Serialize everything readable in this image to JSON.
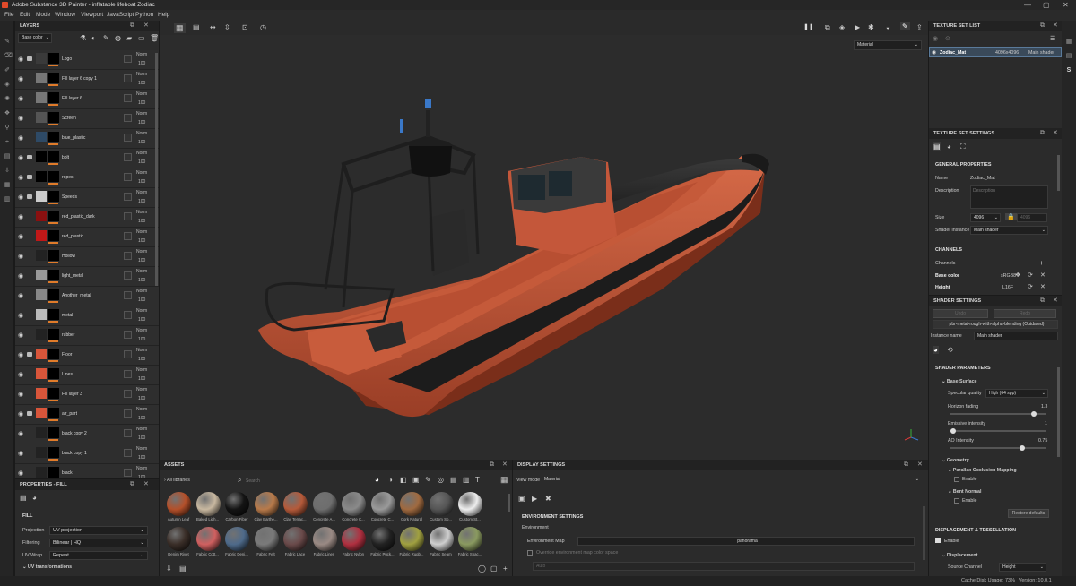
{
  "window": {
    "title": "Adobe Substance 3D Painter - inflatable lifeboat Zodiac",
    "controls": [
      "—",
      "▢",
      "✕"
    ]
  },
  "menu": [
    "File",
    "Edit",
    "Mode",
    "Window",
    "Viewport",
    "JavaScript",
    "Python",
    "Help"
  ],
  "layers": {
    "title": "LAYERS",
    "channel": "Base color",
    "items": [
      {
        "name": "Logo",
        "blend": "Norm",
        "opacity": "100",
        "thumb": "#3a3a3a",
        "folder": true
      },
      {
        "name": "Fill layer 6 copy 1",
        "blend": "Norm",
        "opacity": "100",
        "thumb": "#777",
        "folder": false
      },
      {
        "name": "Fill layer 6",
        "blend": "Norm",
        "opacity": "100",
        "thumb": "#777",
        "folder": false
      },
      {
        "name": "Screen",
        "blend": "Norm",
        "opacity": "100",
        "thumb": "#555",
        "folder": false
      },
      {
        "name": "blue_plastic",
        "blend": "Norm",
        "opacity": "100",
        "thumb": "#2e4a66",
        "folder": false
      },
      {
        "name": "bolt",
        "blend": "Norm",
        "opacity": "100",
        "thumb": "#000",
        "folder": true
      },
      {
        "name": "ropes",
        "blend": "Norm",
        "opacity": "100",
        "thumb": "#000",
        "folder": true
      },
      {
        "name": "Speeds",
        "blend": "Norm",
        "opacity": "100",
        "thumb": "#ccc",
        "folder": true
      },
      {
        "name": "red_plastic_dark",
        "blend": "Norm",
        "opacity": "100",
        "thumb": "#8a1010",
        "folder": false
      },
      {
        "name": "red_plastic",
        "blend": "Norm",
        "opacity": "100",
        "thumb": "#c01818",
        "folder": false
      },
      {
        "name": "Hollow",
        "blend": "Norm",
        "opacity": "100",
        "thumb": "#222",
        "folder": false
      },
      {
        "name": "light_metal",
        "blend": "Norm",
        "opacity": "100",
        "thumb": "#999",
        "folder": false
      },
      {
        "name": "Another_metal",
        "blend": "Norm",
        "opacity": "100",
        "thumb": "#888",
        "folder": false
      },
      {
        "name": "metal",
        "blend": "Norm",
        "opacity": "100",
        "thumb": "#bbb",
        "folder": false
      },
      {
        "name": "rubber",
        "blend": "Norm",
        "opacity": "100",
        "thumb": "#222",
        "folder": false
      },
      {
        "name": "Floor",
        "blend": "Norm",
        "opacity": "100",
        "thumb": "#d8553a",
        "folder": true
      },
      {
        "name": "Lines",
        "blend": "Norm",
        "opacity": "100",
        "thumb": "#d8553a",
        "folder": false
      },
      {
        "name": "Fill layer 3",
        "blend": "Norm",
        "opacity": "100",
        "thumb": "#d8553a",
        "folder": false
      },
      {
        "name": "air_part",
        "blend": "Norm",
        "opacity": "100",
        "thumb": "#d8553a",
        "folder": true
      },
      {
        "name": "black copy 2",
        "blend": "Norm",
        "opacity": "100",
        "thumb": "#222",
        "folder": false
      },
      {
        "name": "black copy 1",
        "blend": "Norm",
        "opacity": "100",
        "thumb": "#222",
        "folder": false
      },
      {
        "name": "black",
        "blend": "Norm",
        "opacity": "100",
        "thumb": "#222",
        "folder": false
      }
    ]
  },
  "properties": {
    "title": "PROPERTIES - FILL",
    "section": "FILL",
    "fields": [
      {
        "label": "Projection",
        "value": "UV projection"
      },
      {
        "label": "Filtering",
        "value": "Bilinear | HQ"
      },
      {
        "label": "UV Wrap",
        "value": "Repeat"
      }
    ],
    "uv_transform": "UV transformations"
  },
  "viewport": {
    "mode": "Material"
  },
  "assets": {
    "title": "ASSETS",
    "library": "All libraries",
    "search_placeholder": "Search",
    "row1": [
      {
        "name": "Autumn Leaf",
        "color": "#b4502a"
      },
      {
        "name": "Baked Ligh...",
        "color": "#c8b8a0"
      },
      {
        "name": "Carbon Fiber",
        "color": "#141414"
      },
      {
        "name": "Clay Earthe...",
        "color": "#b87a4a"
      },
      {
        "name": "Clay Terrac...",
        "color": "#b55a3a"
      },
      {
        "name": "Concrete A...",
        "color": "#6e6e6e"
      },
      {
        "name": "Concrete C...",
        "color": "#8a8a8a"
      },
      {
        "name": "Concrete C...",
        "color": "#9a9a9a"
      },
      {
        "name": "Cork Natural",
        "color": "#a06a40"
      },
      {
        "name": "Custom Sp...",
        "color": "#555"
      },
      {
        "name": "Custom St...",
        "color": "#eee"
      }
    ],
    "row2": [
      {
        "name": "Denim Rivet",
        "color": "#3a2e28"
      },
      {
        "name": "Fabric Cott...",
        "color": "#d06060"
      },
      {
        "name": "Fabric Deni...",
        "color": "#4e6a8a"
      },
      {
        "name": "Fabric Felt",
        "color": "#7a7a7a"
      },
      {
        "name": "Fabric Lace",
        "color": "#6a4a4a"
      },
      {
        "name": "Fabric Linen",
        "color": "#9a8a84"
      },
      {
        "name": "Fabric Nylon",
        "color": "#b03040"
      },
      {
        "name": "Fabric Puck...",
        "color": "#222"
      },
      {
        "name": "Fabric Rugb...",
        "color": "#a0a040"
      },
      {
        "name": "Fabric Seam",
        "color": "#cfcfcf"
      },
      {
        "name": "Fabric Spac...",
        "color": "#8a9a60"
      }
    ]
  },
  "display": {
    "title": "DISPLAY SETTINGS",
    "view_mode_label": "View mode",
    "view_mode": "Material",
    "env_title": "ENVIRONMENT SETTINGS",
    "env_label": "Environment",
    "env_map_label": "Environment Map",
    "env_map": "panorama",
    "override_label": "Override environment map color space",
    "auto_label": "Auto"
  },
  "texture_set_list": {
    "title": "TEXTURE SET LIST",
    "name": "Zodiac_Mat",
    "size": "4096x4096",
    "shader": "Main shader"
  },
  "texture_set_settings": {
    "title": "TEXTURE SET SETTINGS",
    "general": "GENERAL PROPERTIES",
    "name_label": "Name",
    "name": "Zodiac_Mat",
    "desc_label": "Description",
    "desc_placeholder": "Description",
    "size_label": "Size",
    "size": "4096",
    "size2": "4096",
    "shader_label": "Shader instance",
    "shader": "Main shader",
    "channels_title": "CHANNELS",
    "channels_label": "Channels",
    "channels": [
      {
        "name": "Base color",
        "format": "sRGB8"
      },
      {
        "name": "Height",
        "format": "L16F"
      }
    ]
  },
  "shader_settings": {
    "title": "SHADER SETTINGS",
    "btn1": "Undo",
    "btn2": "Redo",
    "shader_name": "pbr-metal-rough-with-alpha-blending (Outdated)",
    "instance_label": "Instance name",
    "instance": "Main shader",
    "params_title": "SHADER PARAMETERS",
    "base_surface": "Base Surface",
    "spec_label": "Specular quality",
    "spec": "High (64 spp)",
    "horizon_label": "Horizon fading",
    "horizon": "1.3",
    "horizon_frac": 0.87,
    "emissive_label": "Emissive intensity",
    "emissive": "1",
    "emissive_frac": 0.04,
    "ao_label": "AO Intensity",
    "ao": "0.75",
    "ao_frac": 0.75,
    "geometry": "Geometry",
    "pom": "Parallax Occlusion Mapping",
    "enable": "Enable",
    "bent": "Bent Normal",
    "enable2": "Enable",
    "restore": "Restore defaults",
    "disp_title": "DISPLACEMENT & TESSELLATION",
    "disp_enable": "Enable",
    "displacement": "Displacement",
    "source_label": "Source Channel",
    "source": "Height"
  },
  "status": {
    "cache": "Cache Disk Usage:",
    "cache_val": "73%",
    "version": "Version: 10.0.1"
  },
  "colors": {
    "accent": "#e07b2a",
    "hull": "#c45a3c",
    "tube": "#2a2a2a"
  }
}
